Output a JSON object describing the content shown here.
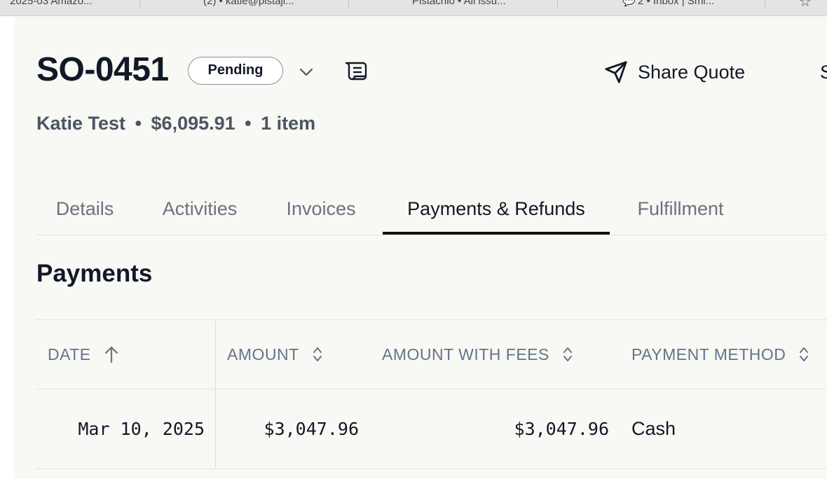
{
  "browser_tabs": [
    {
      "label": "2025-03 Amazo..."
    },
    {
      "label": "(2) • katie@pistaji..."
    },
    {
      "label": "Pistachio • All issu..."
    },
    {
      "label": "2 • Inbox | Smi..."
    }
  ],
  "header": {
    "order_id": "SO-0451",
    "status": "Pending",
    "share_label": "Share Quote",
    "cut_letter": "S",
    "customer": "Katie Test",
    "total": "$6,095.91",
    "items": "1 item",
    "separator": "•"
  },
  "tabs": [
    {
      "label": "Details"
    },
    {
      "label": "Activities"
    },
    {
      "label": "Invoices"
    },
    {
      "label": "Payments & Refunds"
    },
    {
      "label": "Fulfillment"
    }
  ],
  "active_tab": "Payments & Refunds",
  "payments": {
    "title": "Payments",
    "columns": [
      {
        "label": "DATE",
        "sort": "ascending"
      },
      {
        "label": "AMOUNT",
        "sort": "none"
      },
      {
        "label": "AMOUNT WITH FEES",
        "sort": "none"
      },
      {
        "label": "PAYMENT METHOD",
        "sort": "none"
      }
    ],
    "rows": [
      {
        "date": "Mar 10, 2025",
        "amount": "$3,047.96",
        "amount_with_fees": "$3,047.96",
        "method": "Cash"
      }
    ]
  },
  "colors": {
    "accent": "#111111",
    "background": "#f8f8f4",
    "muted_text": "#6b7280",
    "header_text": "#64748b"
  }
}
